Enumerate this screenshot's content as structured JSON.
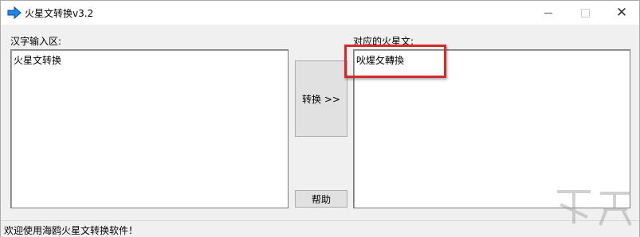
{
  "window": {
    "title": "火星文转换v3.2",
    "icon": "arrow-right-icon",
    "controls": {
      "minimize": "minimize-icon",
      "maximize": "maximize-icon",
      "close": "close-icon",
      "close_glyph": "✕"
    }
  },
  "input": {
    "label": "汉字输入区:",
    "value": "火星文转换"
  },
  "output": {
    "label": "对应的火星文:",
    "value": "吙煋攵轉換"
  },
  "buttons": {
    "convert": "转换 >>",
    "help": "帮助"
  },
  "status": {
    "text": "欢迎使用海鸥火星文转换软件！"
  },
  "colors": {
    "accent": "#1e88e5",
    "highlight": "#d42a2a",
    "window_bg": "#f0f0f0"
  }
}
